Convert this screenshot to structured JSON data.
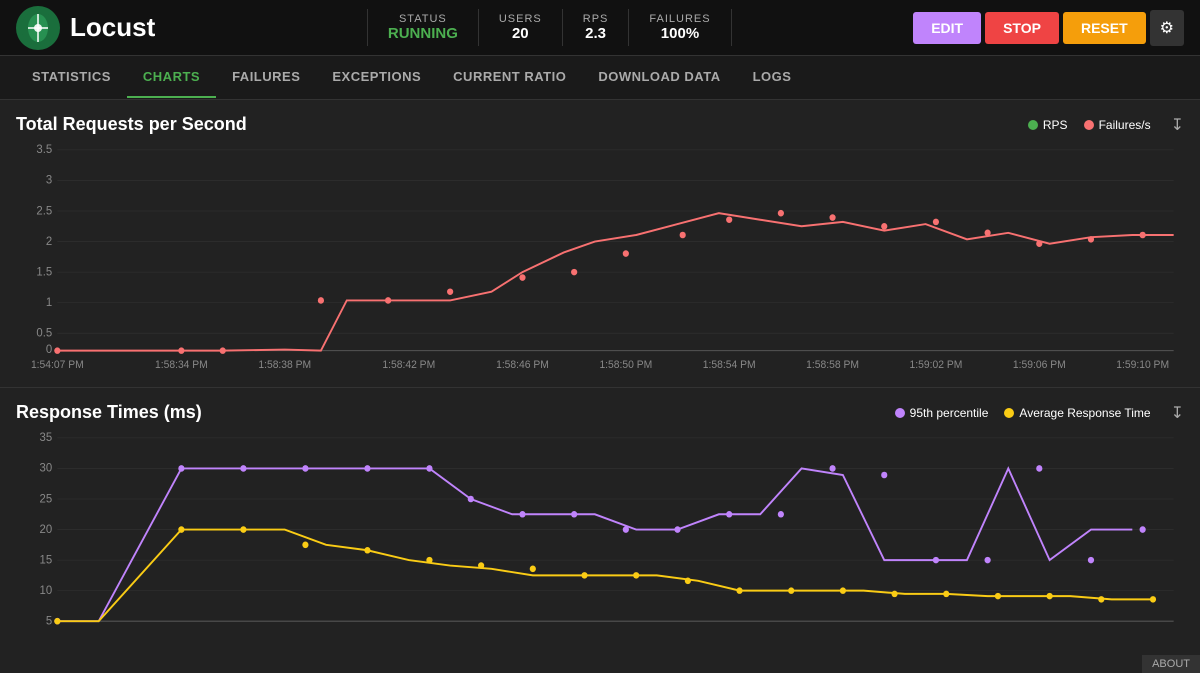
{
  "app": {
    "title": "Locust"
  },
  "header": {
    "status_label": "STATUS",
    "status_value": "RUNNING",
    "users_label": "USERS",
    "users_value": "20",
    "rps_label": "RPS",
    "rps_value": "2.3",
    "failures_label": "FAILURES",
    "failures_value": "100%",
    "btn_edit": "EDIT",
    "btn_stop": "STOP",
    "btn_reset": "RESET"
  },
  "nav": {
    "items": [
      {
        "label": "STATISTICS",
        "active": false
      },
      {
        "label": "CHARTS",
        "active": true
      },
      {
        "label": "FAILURES",
        "active": false
      },
      {
        "label": "EXCEPTIONS",
        "active": false
      },
      {
        "label": "CURRENT RATIO",
        "active": false
      },
      {
        "label": "DOWNLOAD DATA",
        "active": false
      },
      {
        "label": "LOGS",
        "active": false
      }
    ]
  },
  "charts": {
    "chart1": {
      "title": "Total Requests per Second",
      "legend": [
        {
          "label": "RPS",
          "color": "#4caf50"
        },
        {
          "label": "Failures/s",
          "color": "#f87171"
        }
      ],
      "y_labels": [
        "3.5",
        "3",
        "2.5",
        "2",
        "1.5",
        "1",
        "0.5",
        "0"
      ],
      "x_labels": [
        "1:54:07 PM",
        "1:58:34 PM",
        "1:58:38 PM",
        "1:58:42 PM",
        "1:58:46 PM",
        "1:58:50 PM",
        "1:58:54 PM",
        "1:58:58 PM",
        "1:59:02 PM",
        "1:59:06 PM",
        "1:59:10 PM"
      ]
    },
    "chart2": {
      "title": "Response Times (ms)",
      "legend": [
        {
          "label": "95th percentile",
          "color": "#c084fc"
        },
        {
          "label": "Average Response Time",
          "color": "#facc15"
        }
      ],
      "y_labels": [
        "35",
        "30",
        "25",
        "20",
        "15",
        "10",
        "5"
      ],
      "x_labels": []
    }
  },
  "about": "ABOUT"
}
